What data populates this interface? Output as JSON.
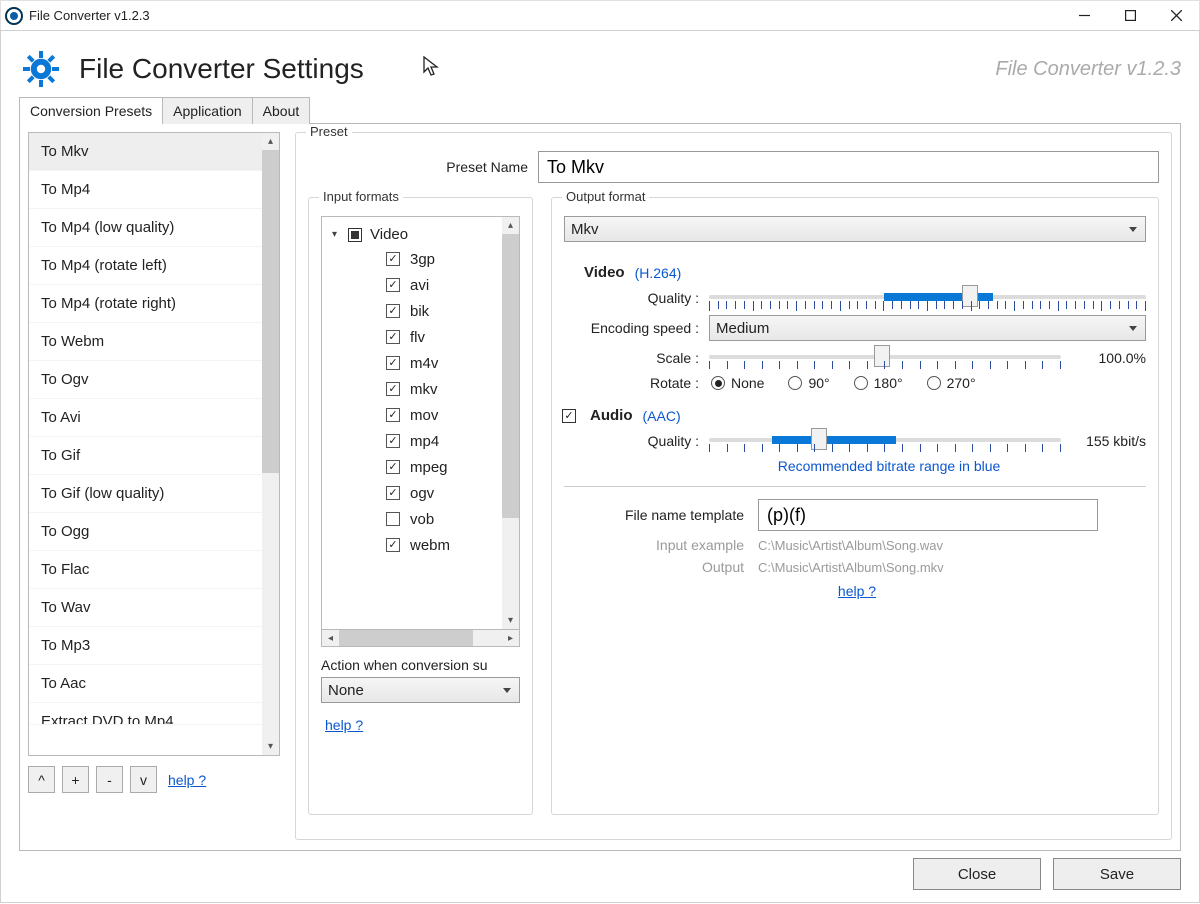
{
  "window": {
    "title": "File Converter v1.2.3"
  },
  "header": {
    "title": "File Converter Settings",
    "right": "File Converter v1.2.3"
  },
  "tabs": {
    "presets": "Conversion Presets",
    "application": "Application",
    "about": "About"
  },
  "presets": {
    "items": [
      "To Mkv",
      "To Mp4",
      "To Mp4 (low quality)",
      "To Mp4 (rotate left)",
      "To Mp4 (rotate right)",
      "To Webm",
      "To Ogv",
      "To Avi",
      "To Gif",
      "To Gif (low quality)",
      "To Ogg",
      "To Flac",
      "To Wav",
      "To Mp3",
      "To Aac",
      "Extract DVD to Mp4"
    ],
    "selected_index": 0,
    "btn_up": "^",
    "btn_add": "+",
    "btn_remove": "-",
    "btn_down": "v",
    "help": "help ?"
  },
  "preset_panel": {
    "legend": "Preset",
    "name_label": "Preset Name",
    "name_value": "To Mkv",
    "input_formats": {
      "legend": "Input formats",
      "group": "Video",
      "items": [
        {
          "label": "3gp",
          "checked": true
        },
        {
          "label": "avi",
          "checked": true
        },
        {
          "label": "bik",
          "checked": true
        },
        {
          "label": "flv",
          "checked": true
        },
        {
          "label": "m4v",
          "checked": true
        },
        {
          "label": "mkv",
          "checked": true
        },
        {
          "label": "mov",
          "checked": true
        },
        {
          "label": "mp4",
          "checked": true
        },
        {
          "label": "mpeg",
          "checked": true
        },
        {
          "label": "ogv",
          "checked": true
        },
        {
          "label": "vob",
          "checked": false
        },
        {
          "label": "webm",
          "checked": true
        }
      ],
      "action_label": "Action when conversion su",
      "action_value": "None",
      "help": "help ?"
    },
    "output": {
      "legend": "Output format",
      "format": "Mkv",
      "video": {
        "label": "Video",
        "codec": "(H.264)",
        "quality_label": "Quality :",
        "enc_label": "Encoding speed :",
        "enc_value": "Medium",
        "scale_label": "Scale :",
        "scale_value": "100.0%",
        "rotate_label": "Rotate :",
        "rotate_options": [
          "None",
          "90°",
          "180°",
          "270°"
        ],
        "rotate_selected": 0
      },
      "audio": {
        "label": "Audio",
        "codec": "(AAC)",
        "quality_label": "Quality :",
        "value": "155 kbit/s",
        "hint": "Recommended bitrate range in blue"
      },
      "file": {
        "label": "File name template",
        "value": "(p)(f)",
        "in_l": "Input example",
        "in_v": "C:\\Music\\Artist\\Album\\Song.wav",
        "out_l": "Output",
        "out_v": "C:\\Music\\Artist\\Album\\Song.mkv",
        "help": "help ?"
      }
    }
  },
  "buttons": {
    "close": "Close",
    "save": "Save"
  }
}
